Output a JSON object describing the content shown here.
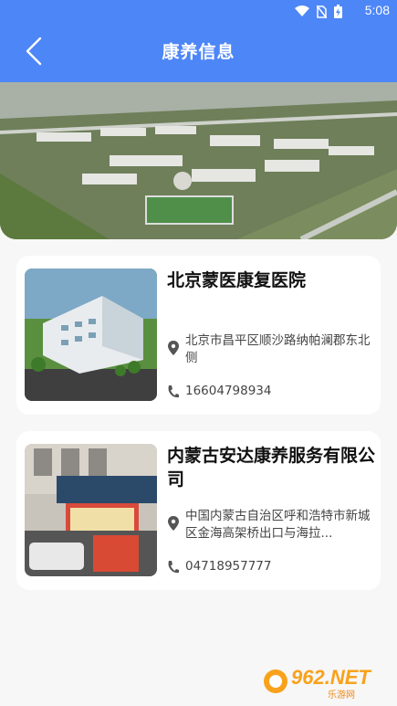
{
  "status_bar": {
    "time": "5:08",
    "icons": [
      "wifi-icon",
      "no-sim-icon",
      "battery-charging-icon"
    ]
  },
  "header": {
    "title": "康养信息",
    "back_icon": "chevron-left-icon",
    "bg_color": "#4d86f7"
  },
  "items": [
    {
      "name": "北京蒙医康复医院",
      "address": "北京市昌平区顺沙路纳帕澜郡东北侧",
      "phone": "16604798934"
    },
    {
      "name": "内蒙古安达康养服务有限公司",
      "address": "中国内蒙古自治区呼和浩特市新城区金海高架桥出口与海拉...",
      "phone": "04718957777"
    }
  ],
  "watermark": {
    "number": "962.NET",
    "subtitle": "乐游网"
  }
}
